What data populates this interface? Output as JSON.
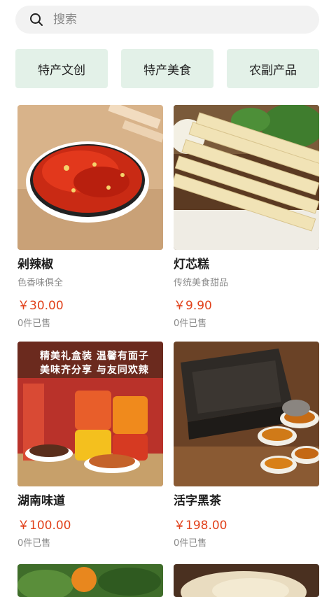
{
  "search": {
    "placeholder": "搜索"
  },
  "categories": [
    "特产文创",
    "特产美食",
    "农副产品"
  ],
  "products": [
    {
      "name": "剁辣椒",
      "desc": "色香味俱全",
      "price": "￥30.00",
      "sold": "0件已售"
    },
    {
      "name": "灯芯糕",
      "desc": "传统美食甜品",
      "price": "￥9.90",
      "sold": "0件已售"
    },
    {
      "name": "湖南味道",
      "desc": "",
      "price": "￥100.00",
      "sold": "0件已售"
    },
    {
      "name": "活字黑茶",
      "desc": "",
      "price": "￥198.00",
      "sold": "0件已售"
    }
  ],
  "banner_text": {
    "line1": "精美礼盒装  温馨有面子",
    "line2": "美味齐分享  与友同欢辣"
  },
  "colors": {
    "price": "#e1421c",
    "category_bg": "#e3f1e8",
    "search_bg": "#f2f2f2"
  }
}
